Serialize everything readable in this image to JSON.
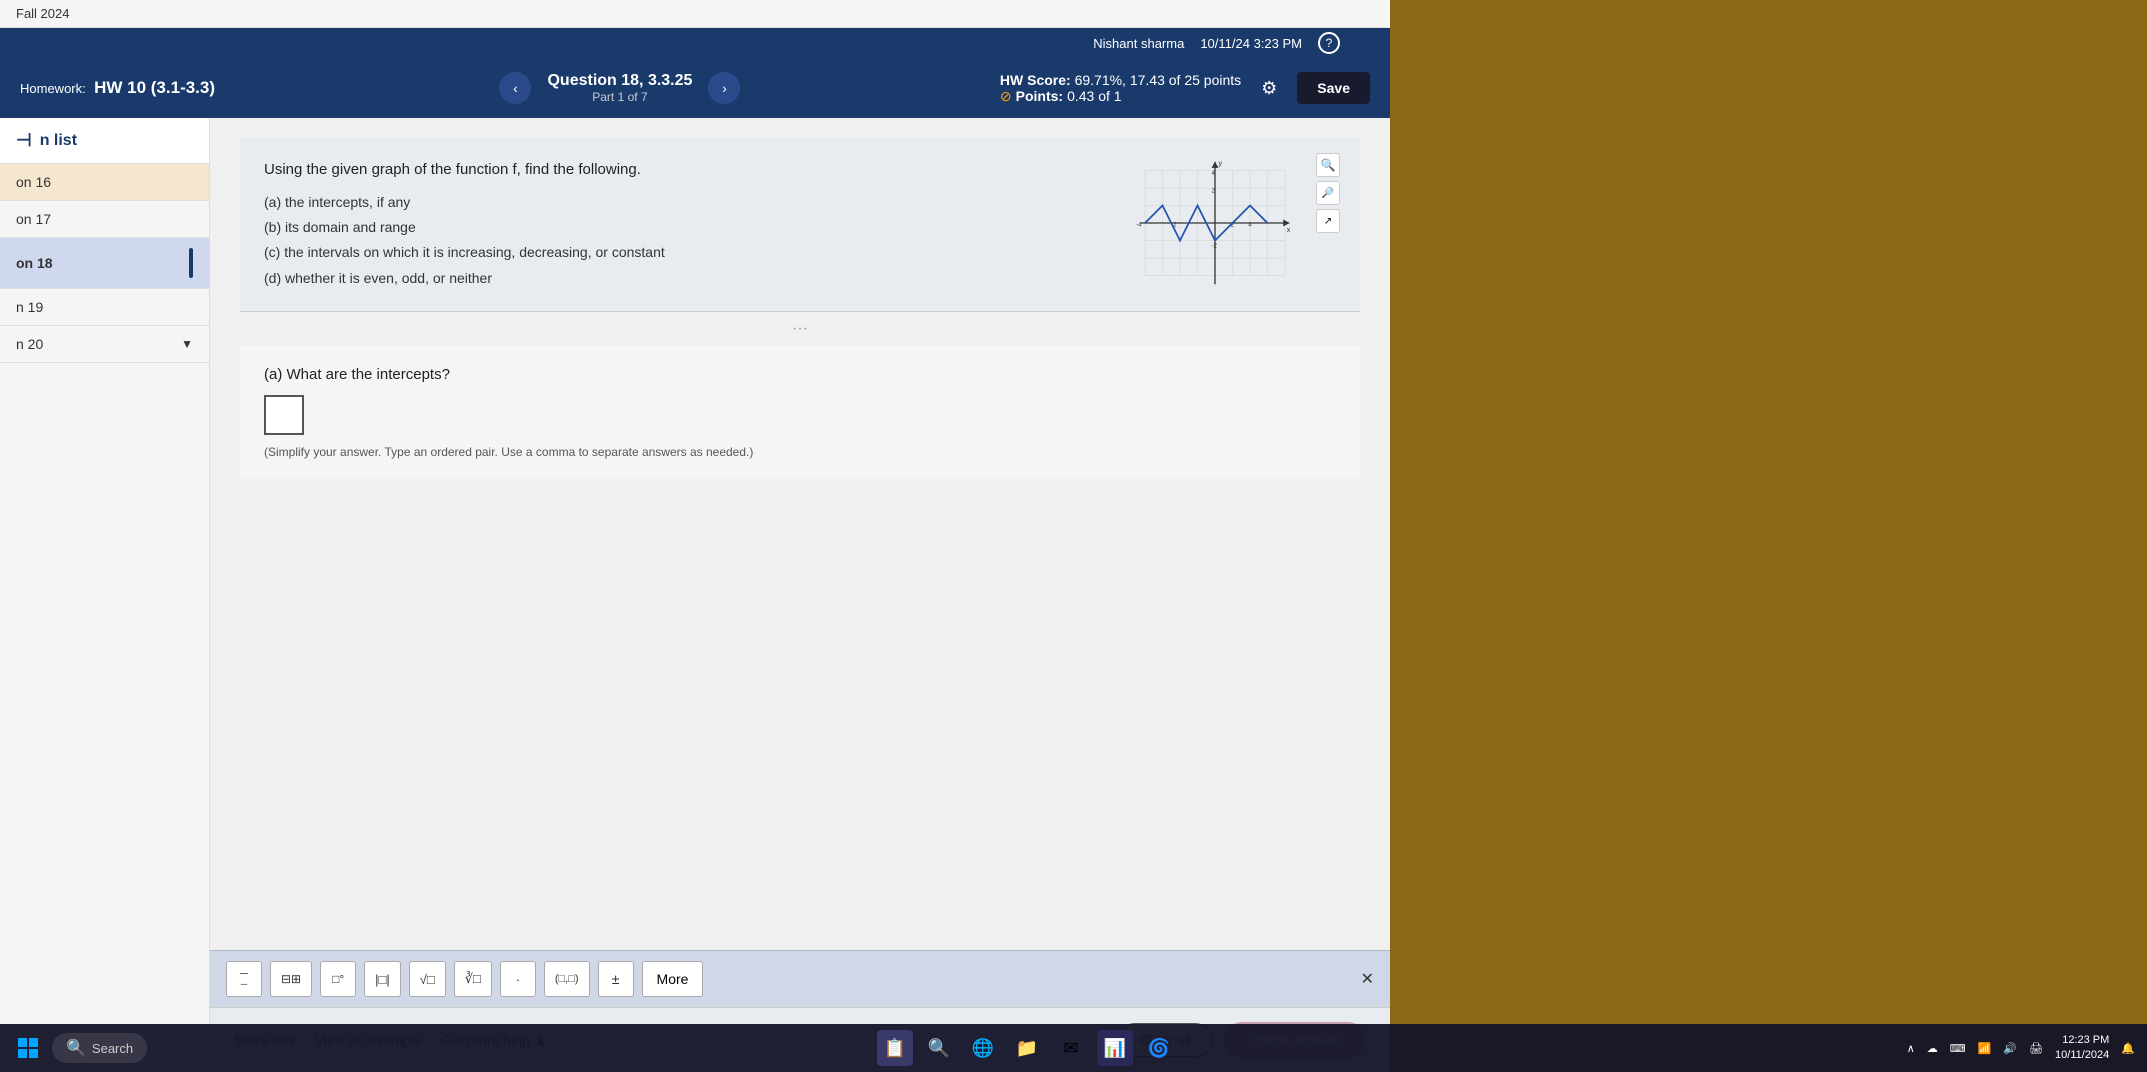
{
  "app": {
    "semester": "Fall 2024",
    "user": {
      "name": "Nishant sharma",
      "datetime": "10/11/24 3:23 PM"
    }
  },
  "header": {
    "homework_title": "HW 10 (3.1-3.3)",
    "question_label": "Question 18, 3.3.25",
    "part_label": "Part 1 of 7",
    "hw_score_label": "HW Score:",
    "hw_score_value": "69.71%, 17.43 of 25 points",
    "points_label": "Points:",
    "points_value": "0.43 of 1",
    "save_label": "Save"
  },
  "sidebar": {
    "title": "n list",
    "collapse_icon": "⊣",
    "items": [
      {
        "label": "on 16",
        "active": false
      },
      {
        "label": "on 17",
        "active": false
      },
      {
        "label": "on 18",
        "active": true
      },
      {
        "label": "n 19",
        "active": false
      },
      {
        "label": "n 20",
        "active": false
      }
    ]
  },
  "question": {
    "instruction": "Using the given graph of the function f, find the following.",
    "parts": [
      "(a)  the intercepts, if any",
      "(b)  its domain and range",
      "(c)  the intervals on which it is increasing, decreasing, or constant",
      "(d)  whether it is even, odd, or neither"
    ],
    "divider": "···",
    "sub_question": "(a)  What are the intercepts?",
    "hint": "(Simplify your answer. Type an ordered pair. Use a comma to separate answers as needed.)"
  },
  "toolbar": {
    "buttons": [
      {
        "label": "≡",
        "name": "fraction-btn"
      },
      {
        "label": "⊞",
        "name": "mixed-number-btn"
      },
      {
        "label": "□°",
        "name": "exponent-btn"
      },
      {
        "label": "|□|",
        "name": "abs-value-btn"
      },
      {
        "label": "√□",
        "name": "sqrt-btn"
      },
      {
        "label": "∛□",
        "name": "cbrt-btn"
      },
      {
        "label": "·",
        "name": "decimal-btn"
      },
      {
        "label": "(□,□)",
        "name": "ordered-pair-btn"
      },
      {
        "label": "±",
        "name": "plus-minus-btn"
      }
    ],
    "more_label": "More",
    "close_label": "×"
  },
  "actions": {
    "solve_this": "Solve this",
    "view_example": "View an example",
    "get_more_help": "Get more help ▲",
    "clear_all": "Clear all",
    "check_answer": "Check answer"
  },
  "taskbar": {
    "search_placeholder": "Search",
    "time": "12:23 PM",
    "date": "10/11/2024"
  }
}
